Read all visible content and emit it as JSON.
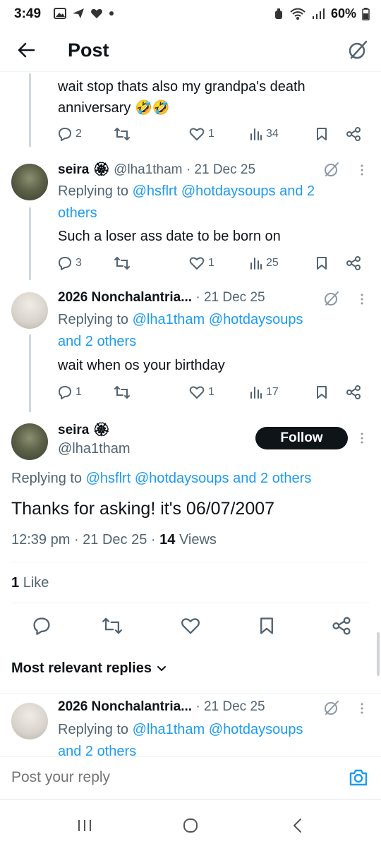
{
  "status_bar": {
    "time": "3:49",
    "battery": "60%"
  },
  "header": {
    "title": "Post"
  },
  "thread": [
    {
      "text": "wait stop thats also my grandpa's death anniversary",
      "emoji": "🤣🤣",
      "replies": "2",
      "likes": "1",
      "views": "34"
    },
    {
      "name": "seira 🏵",
      "handle": "@lha1tham",
      "date": "· 21 Dec 25",
      "replying_prefix": "Replying to",
      "replying_to": "@hsflrt @hotdaysoups and 2",
      "replying_to_2": "others",
      "text": "Such a loser ass date to be born on",
      "replies": "3",
      "likes": "1",
      "views": "25"
    },
    {
      "name": "2026 Nonchalantria...",
      "date": "· 21 Dec 25",
      "replying_prefix": "Replying to",
      "replying_to": "@lha1tham @hotdaysoups",
      "replying_to_2": "and 2 others",
      "text": "wait when os your birthday",
      "replies": "1",
      "likes": "1",
      "views": "17"
    }
  ],
  "main_post": {
    "name": "seira 🏵",
    "handle": "@lha1tham",
    "follow_label": "Follow",
    "replying_prefix": "Replying to",
    "replying_to": "@hsflrt @hotdaysoups and 2 others",
    "text": "Thanks for asking! it's 06/07/2007",
    "time": "12:39 pm",
    "date": "· 21 Dec 25 ·",
    "views_count": "14",
    "views_label": "Views",
    "likes_count": "1",
    "likes_label": "Like"
  },
  "replies_section": {
    "sort_label": "Most relevant replies",
    "first_reply": {
      "name": "2026 Nonchalantria...",
      "date": "· 21 Dec 25",
      "replying_prefix": "Replying to",
      "replying_to": "@lha1tham @hotdaysoups",
      "replying_to_2": "and 2 others"
    }
  },
  "composer": {
    "placeholder": "Post your reply"
  },
  "colors": {
    "link": "#1d9bf0",
    "text": "#0f1419",
    "secondary": "#536471",
    "follow_bg": "#0f1419"
  }
}
